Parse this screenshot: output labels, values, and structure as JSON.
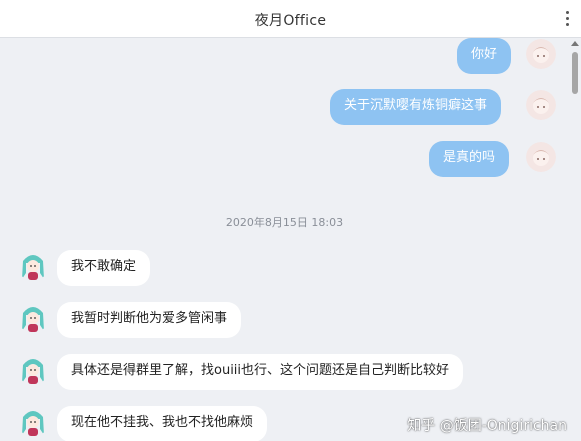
{
  "window": {
    "title": "夜月Office"
  },
  "chat": {
    "outgoing": [
      {
        "text": "你好"
      },
      {
        "text": "关于沉默嘤有炼铜癖这事"
      },
      {
        "text": "是真的吗"
      }
    ],
    "timestamp": "2020年8月15日 18:03",
    "incoming": [
      {
        "text": "我不敢确定"
      },
      {
        "text": "我暂时判断他为爱多管闲事"
      },
      {
        "text": "具体还是得群里了解，找ouiii也行、这个问题还是自己判断比较好"
      },
      {
        "text": "现在他不挂我、我也不找他麻烦"
      }
    ]
  },
  "watermark": "知乎 @饭团-Onigirichan",
  "icons": {
    "menu": "more-vertical-icon",
    "scroll_up": "scroll-up-arrow-icon"
  },
  "colors": {
    "outgoing_bubble": "#8ec3f2",
    "incoming_bubble": "#ffffff",
    "background": "#eef0f4"
  }
}
